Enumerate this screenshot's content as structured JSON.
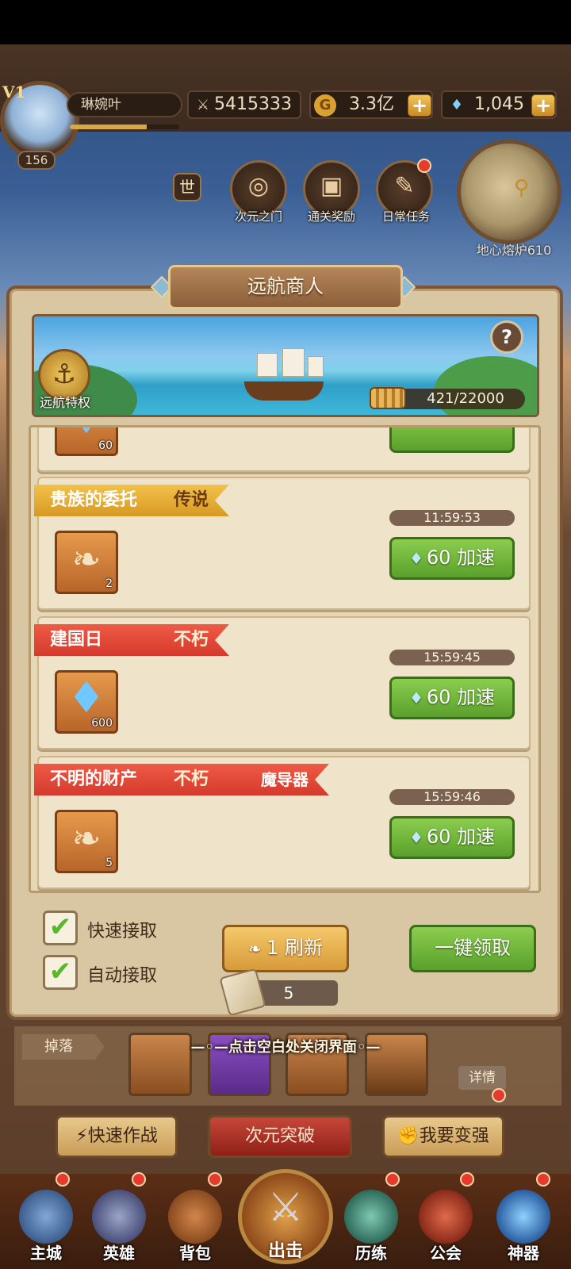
{
  "player": {
    "name": "琳婉叶",
    "vip": "V1",
    "level": "156",
    "exp_fraction": 0.7
  },
  "resources": {
    "power": "5415333",
    "gold": "3.3亿",
    "gems": "1,045"
  },
  "top_buttons": [
    {
      "label": "次元之门",
      "icon": "portal-icon"
    },
    {
      "label": "通关奖励",
      "icon": "gift-icon"
    },
    {
      "label": "日常任务",
      "icon": "quest-scroll-icon"
    }
  ],
  "world_label": "世",
  "map_label": "地心熔炉610",
  "panel": {
    "title": "远航商人",
    "privilege_label": "远航特权",
    "help": "?",
    "progress": "421/22000",
    "partial_item_count": "60"
  },
  "quests": [
    {
      "title": "贵族的委托",
      "rarity": "传说",
      "extra": "",
      "style": "gold",
      "timer": "11:59:53",
      "item_icon": "scroll-icon",
      "item_count": "2",
      "button": "60 加速"
    },
    {
      "title": "建国日",
      "rarity": "不朽",
      "extra": "",
      "style": "red",
      "timer": "15:59:45",
      "item_icon": "diamond-icon",
      "item_count": "600",
      "button": "60 加速"
    },
    {
      "title": "不明的财产",
      "rarity": "不朽",
      "extra": "魔导器",
      "style": "red",
      "timer": "15:59:46",
      "item_icon": "scroll-icon",
      "item_count": "5",
      "button": "60 加速"
    }
  ],
  "options": {
    "quick_accept": "快速接取",
    "auto_accept": "自动接取"
  },
  "buttons": {
    "refresh": "1 刷新",
    "claim_all": "一键领取",
    "refresh_count": "5"
  },
  "close_hint": "—◦—点击空白处关闭界面◦—",
  "drops": {
    "label": "掉落",
    "details": "详情"
  },
  "actions": {
    "quick_battle": "快速作战",
    "breakthrough": "次元突破",
    "power_up": "我要变强"
  },
  "nav": [
    {
      "label": "主城",
      "icon": "castle-icon"
    },
    {
      "label": "英雄",
      "icon": "helmet-icon"
    },
    {
      "label": "背包",
      "icon": "backpack-icon"
    },
    {
      "label": "出击",
      "icon": "crossed-swords-icon"
    },
    {
      "label": "历练",
      "icon": "training-icon"
    },
    {
      "label": "公会",
      "icon": "guild-icon"
    },
    {
      "label": "神器",
      "icon": "orb-icon"
    }
  ],
  "colors": {
    "panel_bg": "#d9c7a4",
    "gold_ribbon": "#f1c14a",
    "red_ribbon": "#ef5a45",
    "green_button": "#5aa02c"
  }
}
